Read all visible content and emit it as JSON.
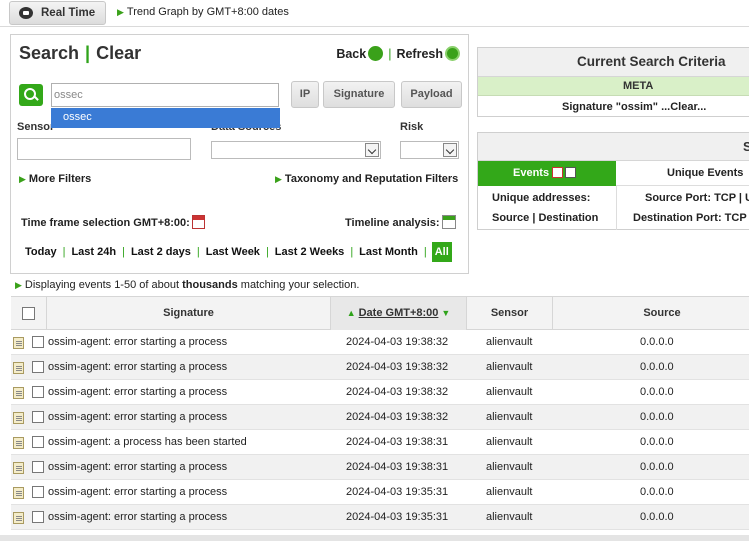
{
  "topbar": {
    "realtime_label": "Real Time",
    "trend_link": "Trend Graph by GMT+8:00 dates"
  },
  "search": {
    "title": "Search",
    "clear": "Clear",
    "back": "Back",
    "refresh": "Refresh",
    "input_value": "ossec",
    "suggestion": "ossec",
    "btn_ip": "IP",
    "btn_signature": "Signature",
    "btn_payload": "Payload",
    "sensor_label": "Sensor",
    "data_sources_label": "Data Sources",
    "risk_label": "Risk",
    "more_filters": "More Filters",
    "taxonomy_filters": "Taxonomy and Reputation Filters",
    "timeframe_label": "Time frame selection GMT+8:00:",
    "timeline_label": "Timeline analysis:",
    "ranges": [
      "Today",
      "Last 24h",
      "Last 2 days",
      "Last Week",
      "Last 2 Weeks",
      "Last Month"
    ],
    "all": "All"
  },
  "criteria": {
    "title": "Current Search Criteria",
    "meta": "META",
    "signature": "Signature \"ossim\" ...Clear..."
  },
  "stats": {
    "title": "S",
    "tab_events": "Events",
    "tab_unique": "Unique Events",
    "unique_addresses": "Unique addresses:",
    "source_dest": "Source | Destination",
    "source_port": "Source Port: TCP | U",
    "dest_port": "Destination Port: TCP"
  },
  "status": {
    "prefix": "Displaying events 1-50 of about",
    "bold": "thousands",
    "suffix": "matching your selection."
  },
  "table": {
    "headers": {
      "signature": "Signature",
      "date": "Date GMT+8:00",
      "sensor": "Sensor",
      "source": "Source"
    },
    "rows": [
      {
        "signature": "ossim-agent: error starting a process",
        "date": "2024-04-03 19:38:32",
        "sensor": "alienvault",
        "source": "0.0.0.0"
      },
      {
        "signature": "ossim-agent: error starting a process",
        "date": "2024-04-03 19:38:32",
        "sensor": "alienvault",
        "source": "0.0.0.0"
      },
      {
        "signature": "ossim-agent: error starting a process",
        "date": "2024-04-03 19:38:32",
        "sensor": "alienvault",
        "source": "0.0.0.0"
      },
      {
        "signature": "ossim-agent: error starting a process",
        "date": "2024-04-03 19:38:32",
        "sensor": "alienvault",
        "source": "0.0.0.0"
      },
      {
        "signature": "ossim-agent: a process has been started",
        "date": "2024-04-03 19:38:31",
        "sensor": "alienvault",
        "source": "0.0.0.0"
      },
      {
        "signature": "ossim-agent: error starting a process",
        "date": "2024-04-03 19:38:31",
        "sensor": "alienvault",
        "source": "0.0.0.0"
      },
      {
        "signature": "ossim-agent: error starting a process",
        "date": "2024-04-03 19:35:31",
        "sensor": "alienvault",
        "source": "0.0.0.0"
      },
      {
        "signature": "ossim-agent: error starting a process",
        "date": "2024-04-03 19:35:31",
        "sensor": "alienvault",
        "source": "0.0.0.0"
      }
    ]
  }
}
